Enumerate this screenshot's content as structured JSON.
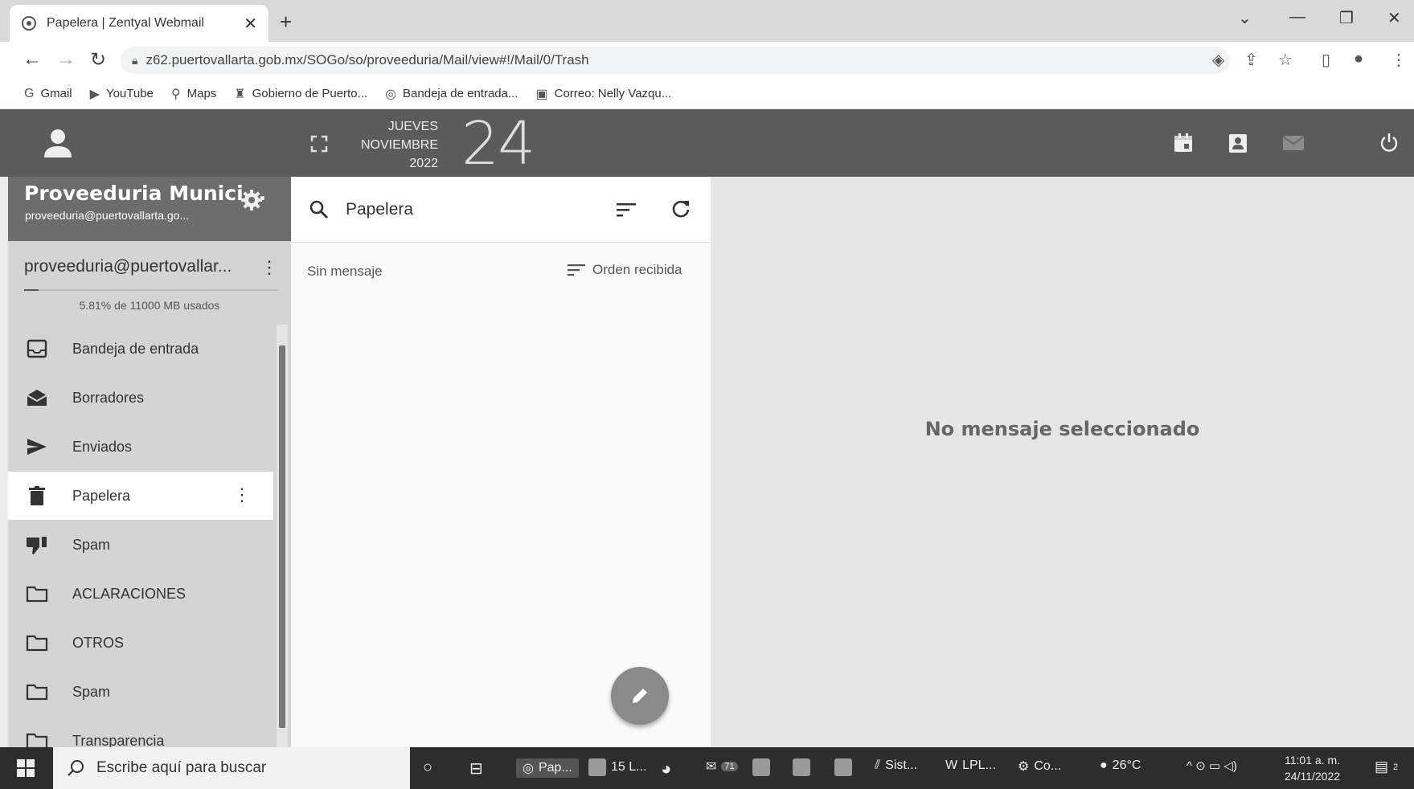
{
  "browser": {
    "tab_title": "Papelera | Zentyal Webmail",
    "url": "z62.puertovallarta.gob.mx/SOGo/so/proveeduria/Mail/view#!/Mail/0/Trash",
    "bookmarks": [
      "Gmail",
      "YouTube",
      "Maps",
      "Gobierno de Puerto...",
      "Bandeja de entrada...",
      "Correo: Nelly Vazqu..."
    ]
  },
  "header": {
    "weekday": "JUEVES",
    "month": "NOVIEMBRE",
    "year": "2022",
    "day": "24"
  },
  "account": {
    "name": "Proveeduria Munici...",
    "email": "proveeduria@puertovallarta.go...",
    "mailbox": "proveeduria@puertovallar...",
    "quota_text": "5.81% de 11000 MB usados",
    "quota_percent": 5.81
  },
  "folders": [
    {
      "label": "Bandeja de entrada",
      "icon": "inbox-icon"
    },
    {
      "label": "Borradores",
      "icon": "drafts-icon"
    },
    {
      "label": "Enviados",
      "icon": "send-icon"
    },
    {
      "label": "Papelera",
      "icon": "trash-icon",
      "active": true
    },
    {
      "label": "Spam",
      "icon": "thumb-down-icon"
    },
    {
      "label": "ACLARACIONES",
      "icon": "folder-icon"
    },
    {
      "label": "OTROS",
      "icon": "folder-icon"
    },
    {
      "label": "Spam",
      "icon": "folder-icon"
    },
    {
      "label": "Transparencia",
      "icon": "folder-icon"
    }
  ],
  "list": {
    "search_label": "Papelera",
    "empty_text": "Sin mensaje",
    "order_label": "Orden recibida"
  },
  "viewer": {
    "no_message": "No mensaje seleccionado"
  },
  "taskbar": {
    "search_placeholder": "Escribe aquí para buscar",
    "items": [
      "Pap...",
      "15 L...",
      "Sist...",
      "LPL...",
      "Co..."
    ],
    "mail_badge": "71",
    "temperature": "26°C",
    "time": "11:01 a. m.",
    "date": "24/11/2022",
    "notif_count": "2"
  }
}
